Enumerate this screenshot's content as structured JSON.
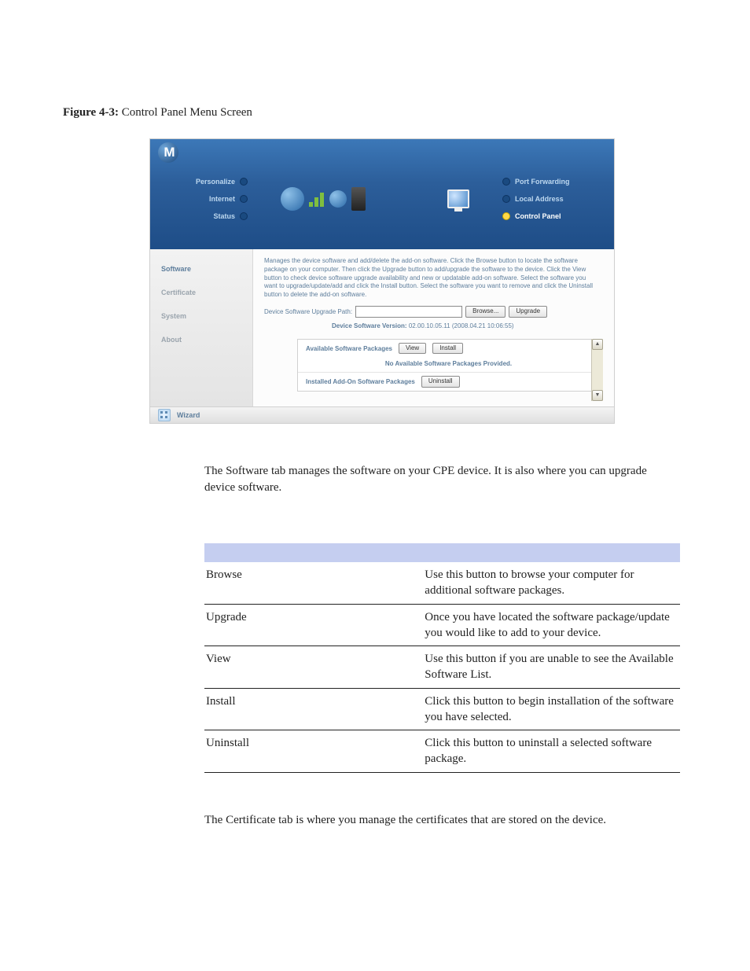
{
  "figure": {
    "label": "Figure 4-3:",
    "title": "Control Panel Menu Screen"
  },
  "screenshot": {
    "leftNav": [
      {
        "label": "Personalize",
        "active": false
      },
      {
        "label": "Internet",
        "active": false
      },
      {
        "label": "Status",
        "active": false
      }
    ],
    "rightNav": [
      {
        "label": "Port Forwarding",
        "active": false
      },
      {
        "label": "Local Address",
        "active": false
      },
      {
        "label": "Control Panel",
        "active": true
      }
    ],
    "sidebar": [
      {
        "label": "Software",
        "active": true
      },
      {
        "label": "Certificate",
        "active": false
      },
      {
        "label": "System",
        "active": false
      },
      {
        "label": "About",
        "active": false
      }
    ],
    "description": "Manages the device software and add/delete the add-on software. Click the Browse button to locate the software package on your computer. Then click the Upgrade button to add/upgrade the software to the device. Click the View button to check device software upgrade availability and new or updatable add-on software. Select the software you want to upgrade/update/add and click the Install button. Select the software you want to remove and click the Uninstall button to delete the add-on software.",
    "upgradePathLabel": "Device Software Upgrade Path:",
    "upgradePathValue": "",
    "browse": "Browse...",
    "upgrade": "Upgrade",
    "versionLabel": "Device Software Version:",
    "versionValue": "02.00.10.05.11 (2008.04.21 10:06:55)",
    "availableTitle": "Available Software Packages",
    "viewBtn": "View",
    "installBtn": "Install",
    "noAvailable": "No Available Software Packages Provided.",
    "installedTitle": "Installed Add-On Software Packages",
    "uninstallBtn": "Uninstall",
    "wizard": "Wizard"
  },
  "paragraphs": {
    "afterFigure": "The Software tab manages the software on your CPE device. It is also where you can upgrade device software.",
    "afterTable": "The Certificate tab is where you manage the certificates that are stored on the device."
  },
  "table": {
    "rows": [
      {
        "name": "Browse",
        "desc": "Use this button to browse your computer for additional software packages."
      },
      {
        "name": "Upgrade",
        "desc": "Once you have located the software package/update you would like to add to your device."
      },
      {
        "name": "View",
        "desc": "Use this button if you are unable to see the Available Software List."
      },
      {
        "name": "Install",
        "desc": "Click this button to begin installation of the software you have selected."
      },
      {
        "name": "Uninstall",
        "desc": "Click this button to uninstall a selected software package."
      }
    ]
  }
}
